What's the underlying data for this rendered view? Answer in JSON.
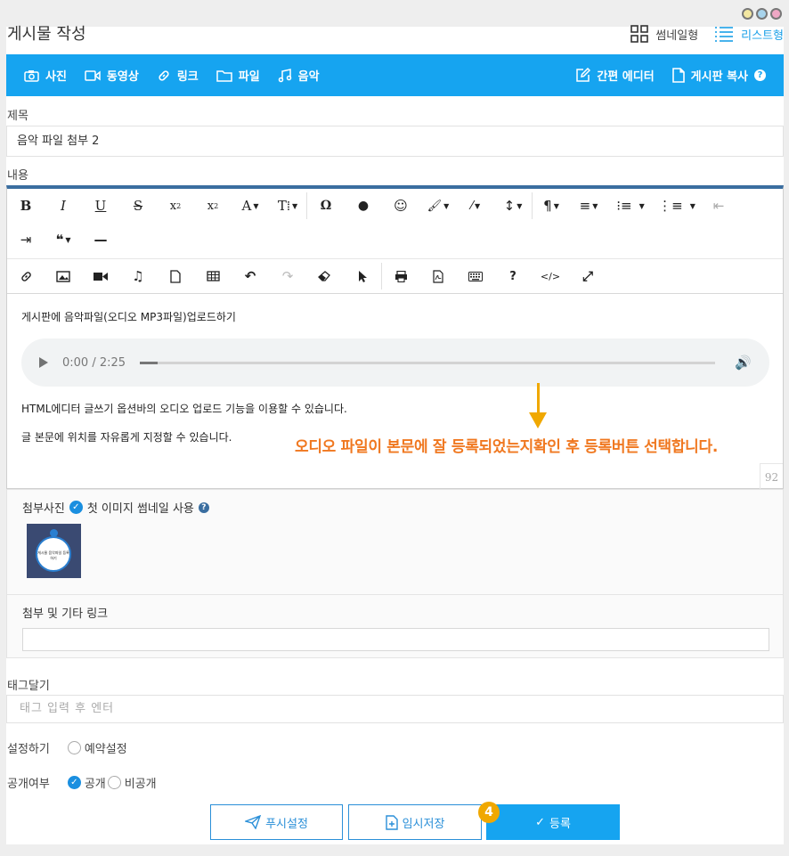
{
  "header": {
    "title": "게시물 작성",
    "view_thumb": "썸네일형",
    "view_list": "리스트형"
  },
  "toolbar_blue": {
    "photo": "사진",
    "video": "동영상",
    "link": "링크",
    "file": "파일",
    "music": "음악",
    "simple_editor": "간편 에디터",
    "copy_board": "게시판 복사"
  },
  "form": {
    "title_label": "제목",
    "title_value": "음악 파일 첨부 2",
    "content_label": "내용"
  },
  "editor": {
    "line1": "게시판에 음악파일(오디오 MP3파일)업로드하기",
    "audio_time": "0:00 / 2:25",
    "line2": "HTML에디터 글쓰기 옵션바의 오디오 업로드 기능을 이용할 수 있습니다.",
    "line3": "글 본문에 위치를 자유롭게 지정할 수 있습니다.",
    "counter": "92"
  },
  "annotation": {
    "text": "오디오 파일이 본문에 잘 등록되었는지확인 후 등록버튼 선택합니다.",
    "badge": "4",
    "color": "#f07820"
  },
  "attach": {
    "photo_label": "첨부사진",
    "thumb_option": "첫 이미지 썸네일 사용",
    "thumb_text": "게시물 음악파일 등록하기",
    "link_label": "첨부 및 기타 링크"
  },
  "tags": {
    "label": "태그달기",
    "placeholder": "태그 입력 후 엔터"
  },
  "settings": {
    "label": "설정하기",
    "reserve": "예약설정"
  },
  "visibility": {
    "label": "공개여부",
    "public": "공개",
    "private": "비공개"
  },
  "buttons": {
    "push": "푸시설정",
    "draft": "임시저장",
    "submit": "등록"
  },
  "colors": {
    "accent": "#16a4f0",
    "editor_top": "#3a6ea0"
  }
}
